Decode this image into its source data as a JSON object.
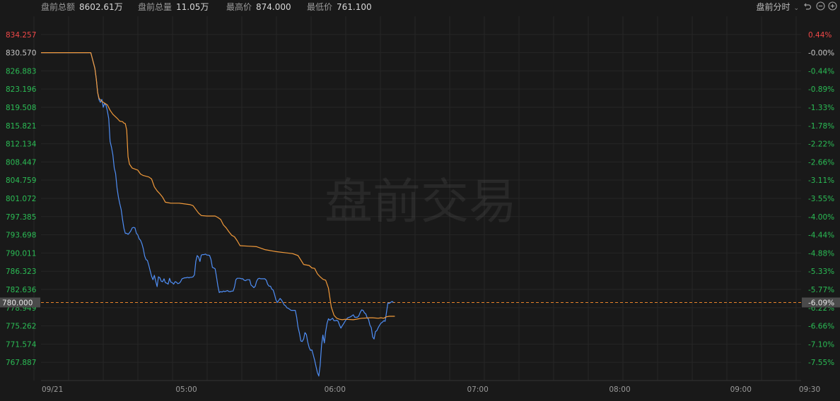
{
  "header": {
    "stats": [
      {
        "label": "盘前总额",
        "value": "8602.61万"
      },
      {
        "label": "盘前总量",
        "value": "11.05万"
      },
      {
        "label": "最高价",
        "value": "874.000"
      },
      {
        "label": "最低价",
        "value": "761.100"
      }
    ],
    "mode_label": "盘前分时",
    "icons": [
      "undo-icon",
      "zoom-out-icon",
      "zoom-in-icon"
    ]
  },
  "colors": {
    "background": "#191919",
    "up": "#f04848",
    "down": "#2bbd55",
    "price_line": "#4f8ef5",
    "avg_line": "#f29a3a",
    "ref_line": "#e8832a",
    "current_tag": "#4a4a4a"
  },
  "chart_data": {
    "type": "line",
    "watermark": "盘前交易",
    "y_left_ticks": [
      "834.257",
      "830.570",
      "826.883",
      "823.196",
      "819.508",
      "815.821",
      "812.134",
      "808.447",
      "804.759",
      "801.072",
      "797.385",
      "793.698",
      "790.011",
      "786.323",
      "782.636",
      "778.949",
      "775.262",
      "771.574",
      "767.887"
    ],
    "y_right_ticks": [
      "0.44%",
      "-0.00%",
      "-0.44%",
      "-0.89%",
      "-1.33%",
      "-1.78%",
      "-2.22%",
      "-2.66%",
      "-3.11%",
      "-3.55%",
      "-4.00%",
      "-4.44%",
      "-4.88%",
      "-5.33%",
      "-5.77%",
      "-6.22%",
      "-6.66%",
      "-7.10%",
      "-7.55%"
    ],
    "ylim": [
      764.2,
      837.94
    ],
    "prev_close": 830.57,
    "x_ticks": [
      "09/21",
      "05:00",
      "06:00",
      "07:00",
      "08:00",
      "09:00",
      "09:30"
    ],
    "current": {
      "price": "780.000",
      "pct": "-6.09%",
      "value": 780.0
    },
    "series": [
      {
        "kind": "price",
        "points": [
          [
            0,
            830.57
          ],
          [
            36,
            830.57
          ],
          [
            39,
            827.4
          ],
          [
            40,
            825.2
          ],
          [
            41,
            822.5
          ],
          [
            42,
            821.0
          ],
          [
            43,
            820.5
          ],
          [
            44,
            821.1
          ],
          [
            45,
            819.5
          ],
          [
            46,
            820.3
          ],
          [
            47,
            819.9
          ],
          [
            48,
            818.8
          ],
          [
            49,
            817.2
          ],
          [
            50,
            812.6
          ],
          [
            51,
            811.4
          ],
          [
            52,
            809.9
          ],
          [
            53,
            807.2
          ],
          [
            54,
            806.1
          ],
          [
            55,
            803.2
          ],
          [
            56,
            801.3
          ],
          [
            57,
            800.0
          ],
          [
            58,
            798.8
          ],
          [
            59,
            796.8
          ],
          [
            60,
            795.0
          ],
          [
            61,
            794.0
          ],
          [
            62,
            794.0
          ],
          [
            63,
            793.8
          ],
          [
            64,
            794.1
          ],
          [
            65,
            794.5
          ],
          [
            66,
            795.1
          ],
          [
            67,
            795.2
          ],
          [
            68,
            795.1
          ],
          [
            69,
            794.0
          ],
          [
            70,
            793.7
          ],
          [
            71,
            792.9
          ],
          [
            72,
            792.6
          ],
          [
            73,
            791.9
          ],
          [
            74,
            790.9
          ],
          [
            75,
            789.4
          ],
          [
            76,
            788.7
          ],
          [
            77,
            788.5
          ],
          [
            78,
            787.5
          ],
          [
            79,
            786.4
          ],
          [
            80,
            785.3
          ],
          [
            81,
            784.6
          ],
          [
            82,
            785.5
          ],
          [
            83,
            784.3
          ],
          [
            84,
            783.2
          ],
          [
            85,
            785.2
          ],
          [
            86,
            785.0
          ],
          [
            87,
            784.3
          ],
          [
            88,
            784.2
          ],
          [
            89,
            784.8
          ],
          [
            90,
            784.0
          ],
          [
            91,
            783.9
          ],
          [
            92,
            783.7
          ],
          [
            93,
            784.9
          ],
          [
            94,
            784.1
          ],
          [
            95,
            784.0
          ],
          [
            96,
            783.7
          ],
          [
            97,
            784.2
          ],
          [
            98,
            784.1
          ],
          [
            99,
            783.8
          ],
          [
            100,
            783.9
          ],
          [
            101,
            784.2
          ],
          [
            102,
            784.8
          ],
          [
            103,
            784.9
          ],
          [
            104,
            785.0
          ],
          [
            105,
            785.0
          ],
          [
            106,
            785.1
          ],
          [
            107,
            785.0
          ],
          [
            108,
            785.1
          ],
          [
            109,
            785.1
          ],
          [
            110,
            785.2
          ],
          [
            111,
            785.6
          ],
          [
            112,
            788.3
          ],
          [
            113,
            789.5
          ],
          [
            114,
            789.2
          ],
          [
            115,
            788.3
          ],
          [
            116,
            789.6
          ],
          [
            117,
            789.7
          ],
          [
            118,
            789.7
          ],
          [
            119,
            789.8
          ],
          [
            120,
            789.6
          ],
          [
            121,
            789.6
          ],
          [
            122,
            789.5
          ],
          [
            123,
            788.7
          ],
          [
            124,
            787.1
          ],
          [
            125,
            787.0
          ],
          [
            126,
            786.8
          ],
          [
            127,
            785.2
          ],
          [
            128,
            783.3
          ],
          [
            129,
            782.0
          ],
          [
            130,
            782.2
          ],
          [
            131,
            782.1
          ],
          [
            132,
            782.3
          ],
          [
            133,
            782.2
          ],
          [
            134,
            782.3
          ],
          [
            135,
            782.4
          ],
          [
            136,
            782.2
          ],
          [
            137,
            782.2
          ],
          [
            138,
            782.3
          ],
          [
            139,
            782.3
          ],
          [
            140,
            783.1
          ],
          [
            141,
            784.6
          ],
          [
            142,
            784.9
          ],
          [
            143,
            784.9
          ],
          [
            144,
            784.9
          ],
          [
            145,
            784.8
          ],
          [
            146,
            784.8
          ],
          [
            147,
            784.5
          ],
          [
            148,
            784.4
          ],
          [
            149,
            784.6
          ],
          [
            150,
            784.6
          ],
          [
            151,
            784.6
          ],
          [
            152,
            783.5
          ],
          [
            153,
            783.3
          ],
          [
            154,
            783.0
          ],
          [
            155,
            783.3
          ],
          [
            156,
            784.3
          ],
          [
            157,
            784.8
          ],
          [
            158,
            784.9
          ],
          [
            159,
            784.8
          ],
          [
            160,
            784.8
          ],
          [
            161,
            784.8
          ],
          [
            162,
            784.8
          ],
          [
            163,
            784.5
          ],
          [
            164,
            783.7
          ],
          [
            165,
            783.3
          ],
          [
            166,
            783.3
          ],
          [
            167,
            782.7
          ],
          [
            168,
            782.5
          ],
          [
            169,
            781.6
          ],
          [
            170,
            780.5
          ],
          [
            171,
            780.0
          ],
          [
            172,
            780.4
          ],
          [
            173,
            780.8
          ],
          [
            174,
            780.5
          ],
          [
            175,
            780.0
          ],
          [
            176,
            779.5
          ],
          [
            177,
            779.3
          ],
          [
            178,
            778.9
          ],
          [
            179,
            778.8
          ],
          [
            180,
            778.6
          ],
          [
            181,
            778.4
          ],
          [
            182,
            778.4
          ],
          [
            183,
            778.4
          ],
          [
            184,
            778.4
          ],
          [
            185,
            777.0
          ],
          [
            186,
            775.0
          ],
          [
            187,
            773.8
          ],
          [
            188,
            772.2
          ],
          [
            189,
            772.1
          ],
          [
            190,
            772.6
          ],
          [
            191,
            773.9
          ],
          [
            192,
            773.5
          ],
          [
            193,
            772.0
          ],
          [
            194,
            770.9
          ],
          [
            195,
            770.3
          ],
          [
            196,
            770.4
          ],
          [
            197,
            769.4
          ],
          [
            198,
            768.3
          ],
          [
            199,
            767.0
          ],
          [
            200,
            765.8
          ],
          [
            201,
            765.1
          ],
          [
            202,
            767.3
          ],
          [
            203,
            771.4
          ],
          [
            204,
            773.4
          ],
          [
            205,
            771.8
          ],
          [
            206,
            774.1
          ],
          [
            207,
            775.8
          ],
          [
            208,
            776.7
          ],
          [
            209,
            776.4
          ],
          [
            210,
            776.6
          ],
          [
            211,
            776.8
          ],
          [
            212,
            776.3
          ],
          [
            213,
            776.3
          ],
          [
            214,
            776.4
          ],
          [
            215,
            776.2
          ],
          [
            216,
            775.4
          ],
          [
            217,
            774.8
          ],
          [
            218,
            775.3
          ],
          [
            219,
            775.7
          ],
          [
            220,
            776.2
          ],
          [
            221,
            776.6
          ],
          [
            222,
            776.9
          ],
          [
            223,
            777.0
          ],
          [
            224,
            777.1
          ],
          [
            225,
            777.3
          ],
          [
            226,
            777.5
          ],
          [
            227,
            777.0
          ],
          [
            228,
            777.0
          ],
          [
            229,
            777.0
          ],
          [
            230,
            777.3
          ],
          [
            231,
            778.0
          ],
          [
            232,
            778.5
          ],
          [
            233,
            778.4
          ],
          [
            234,
            777.9
          ],
          [
            235,
            777.7
          ],
          [
            236,
            776.9
          ],
          [
            237,
            776.6
          ],
          [
            238,
            775.4
          ],
          [
            239,
            774.9
          ],
          [
            240,
            773.0
          ],
          [
            241,
            772.6
          ],
          [
            242,
            774.1
          ],
          [
            243,
            774.3
          ],
          [
            244,
            774.9
          ],
          [
            245,
            775.4
          ],
          [
            246,
            775.8
          ],
          [
            247,
            776.0
          ],
          [
            248,
            776.3
          ],
          [
            249,
            776.2
          ],
          [
            250,
            778.0
          ],
          [
            251,
            779.9
          ],
          [
            252,
            779.8
          ],
          [
            253,
            780.0
          ],
          [
            254,
            780.2
          ],
          [
            255,
            780.0
          ]
        ]
      },
      {
        "kind": "average",
        "points": [
          [
            0,
            830.57
          ],
          [
            36,
            830.57
          ],
          [
            39,
            827.4
          ],
          [
            40,
            825.2
          ],
          [
            41,
            822.5
          ],
          [
            42,
            821.3
          ],
          [
            44,
            820.7
          ],
          [
            48,
            820.0
          ],
          [
            50,
            818.9
          ],
          [
            52,
            818.1
          ],
          [
            55,
            817.3
          ],
          [
            57,
            816.7
          ],
          [
            59,
            816.6
          ],
          [
            60,
            816.3
          ],
          [
            61,
            816.2
          ],
          [
            62,
            814.9
          ],
          [
            63,
            809.5
          ],
          [
            64,
            808.0
          ],
          [
            66,
            807.2
          ],
          [
            70,
            806.8
          ],
          [
            72,
            806.0
          ],
          [
            74,
            805.7
          ],
          [
            78,
            805.4
          ],
          [
            80,
            805.0
          ],
          [
            82,
            803.4
          ],
          [
            84,
            802.6
          ],
          [
            86,
            802.0
          ],
          [
            88,
            801.3
          ],
          [
            90,
            800.3
          ],
          [
            92,
            800.2
          ],
          [
            94,
            800.1
          ],
          [
            100,
            800.1
          ],
          [
            108,
            799.8
          ],
          [
            110,
            799.6
          ],
          [
            114,
            798.1
          ],
          [
            116,
            797.6
          ],
          [
            120,
            797.5
          ],
          [
            126,
            797.5
          ],
          [
            128,
            797.2
          ],
          [
            130,
            796.8
          ],
          [
            132,
            795.7
          ],
          [
            134,
            795.1
          ],
          [
            136,
            794.3
          ],
          [
            138,
            793.6
          ],
          [
            140,
            793.3
          ],
          [
            142,
            792.5
          ],
          [
            144,
            791.5
          ],
          [
            150,
            791.4
          ],
          [
            156,
            791.3
          ],
          [
            162,
            790.7
          ],
          [
            168,
            790.4
          ],
          [
            170,
            790.3
          ],
          [
            176,
            790.1
          ],
          [
            182,
            789.9
          ],
          [
            186,
            789.5
          ],
          [
            188,
            788.6
          ],
          [
            190,
            787.7
          ],
          [
            194,
            787.5
          ],
          [
            196,
            787.0
          ],
          [
            198,
            786.9
          ],
          [
            200,
            785.8
          ],
          [
            202,
            785.2
          ],
          [
            204,
            784.7
          ],
          [
            206,
            784.5
          ],
          [
            208,
            782.9
          ],
          [
            210,
            779.1
          ],
          [
            212,
            777.4
          ],
          [
            214,
            776.8
          ],
          [
            216,
            776.6
          ],
          [
            218,
            776.5
          ],
          [
            220,
            776.6
          ],
          [
            226,
            776.5
          ],
          [
            232,
            776.8
          ],
          [
            238,
            776.9
          ],
          [
            240,
            776.9
          ],
          [
            244,
            776.8
          ],
          [
            246,
            776.9
          ],
          [
            248,
            776.8
          ],
          [
            250,
            777.1
          ],
          [
            252,
            777.2
          ],
          [
            254,
            777.2
          ],
          [
            256,
            777.2
          ]
        ]
      }
    ]
  }
}
